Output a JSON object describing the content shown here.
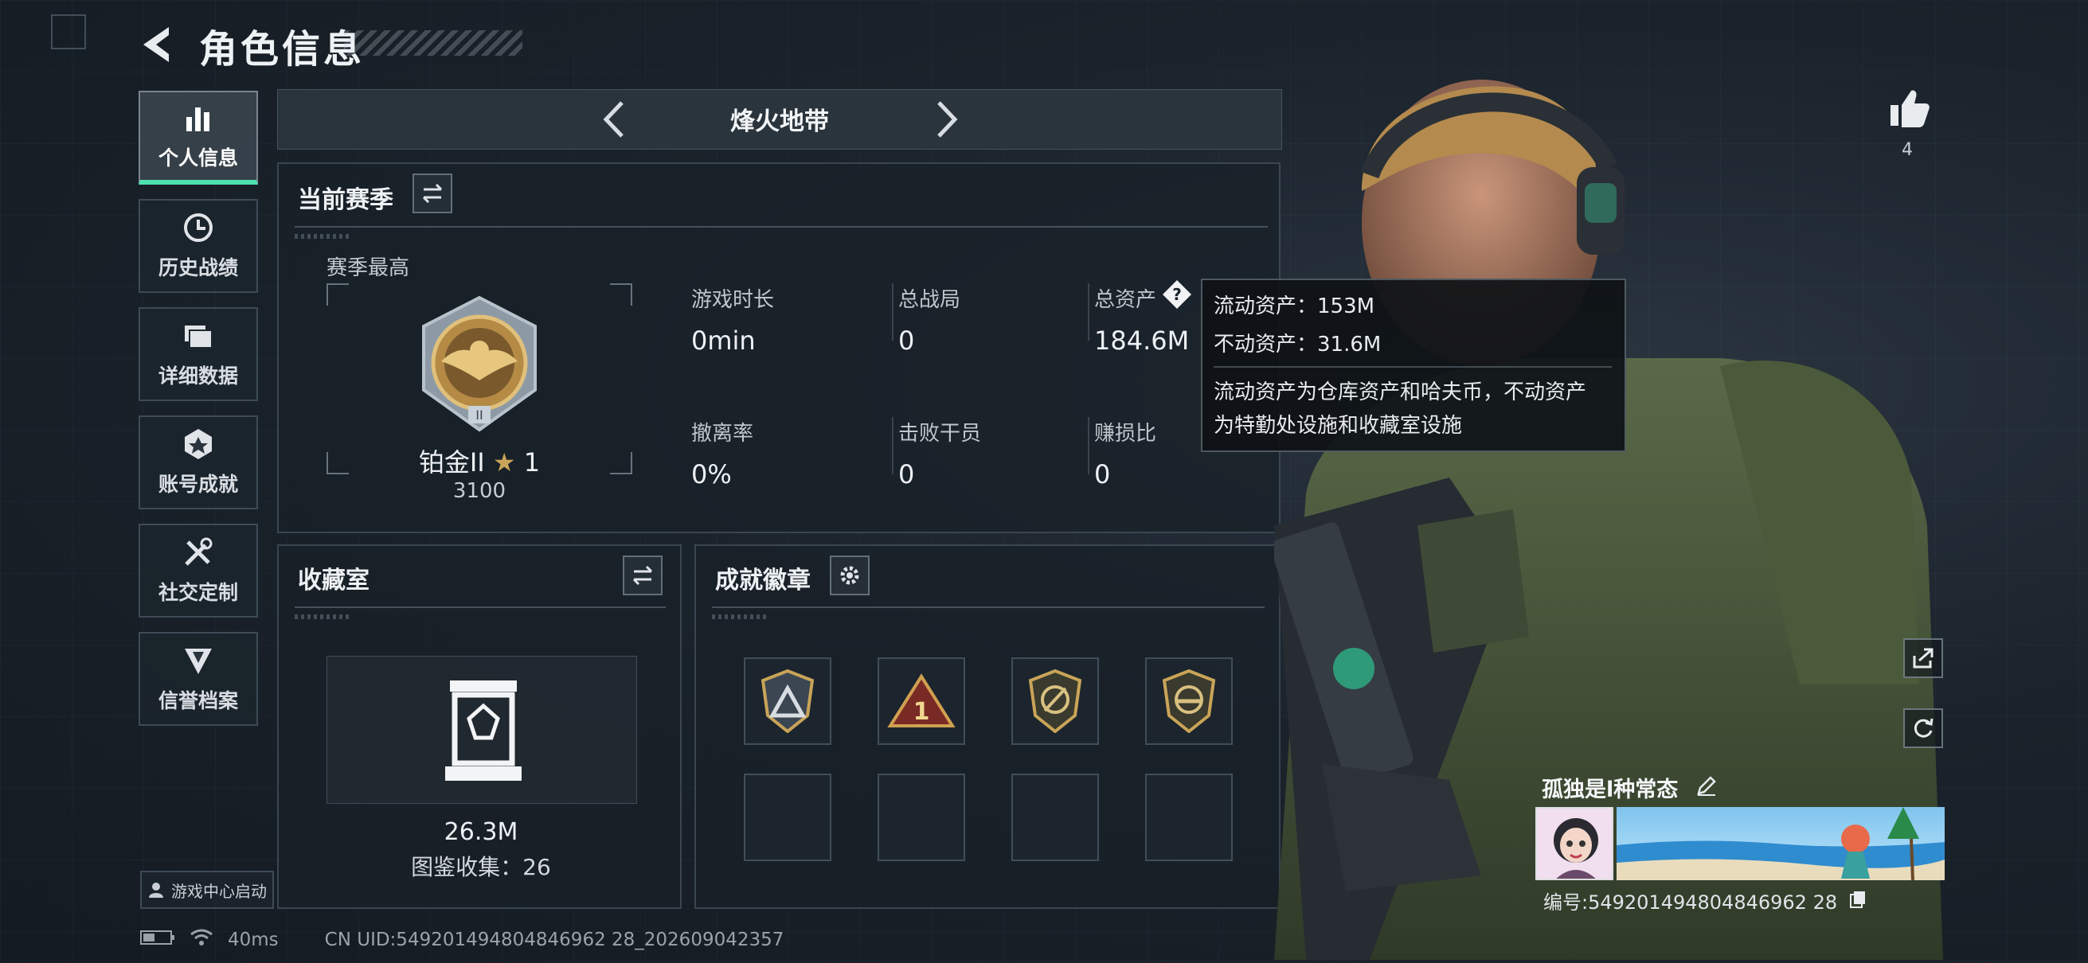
{
  "header": {
    "title": "角色信息"
  },
  "sidebar": {
    "items": [
      {
        "label": "个人信息",
        "icon": "bar-chart-icon",
        "active": true
      },
      {
        "label": "历史战绩",
        "icon": "clock-icon"
      },
      {
        "label": "详细数据",
        "icon": "cards-icon"
      },
      {
        "label": "账号成就",
        "icon": "medal-icon"
      },
      {
        "label": "社交定制",
        "icon": "tools-icon"
      },
      {
        "label": "信誉档案",
        "icon": "shield-icon"
      }
    ],
    "game_center": "游戏中心启动"
  },
  "mode": {
    "title": "烽火地带"
  },
  "season": {
    "title": "当前赛季",
    "best_label": "赛季最高",
    "rank_name": "铂金II",
    "rank_stars": "1",
    "rank_points": "3100",
    "stats": [
      {
        "label": "游戏时长",
        "value": "0min"
      },
      {
        "label": "总战局",
        "value": "0"
      },
      {
        "label": "总资产",
        "value": "184.6M"
      },
      {
        "label": "撤离率",
        "value": "0%"
      },
      {
        "label": "击败干员",
        "value": "0"
      },
      {
        "label": "赚损比",
        "value": "0"
      }
    ]
  },
  "tooltip": {
    "line1": "流动资产：153M",
    "line2": "不动资产：31.6M",
    "desc1": "流动资产为仓库资产和哈夫币，不动资产",
    "desc2": "为特勤处设施和收藏室设施"
  },
  "collection": {
    "title": "收藏室",
    "value": "26.3M",
    "count_text": "图鉴收集：26"
  },
  "achievements": {
    "title": "成就徽章"
  },
  "profile": {
    "likes": "4",
    "name": "孤独是l种常态",
    "id_text": "编号:549201494804846962 28"
  },
  "status": {
    "ping": "40ms",
    "uid": "CN UID:549201494804846962 28_202609042357"
  },
  "colors": {
    "accent": "#4fe0b0",
    "panel": "#18202a",
    "gold": "#c9a458"
  }
}
